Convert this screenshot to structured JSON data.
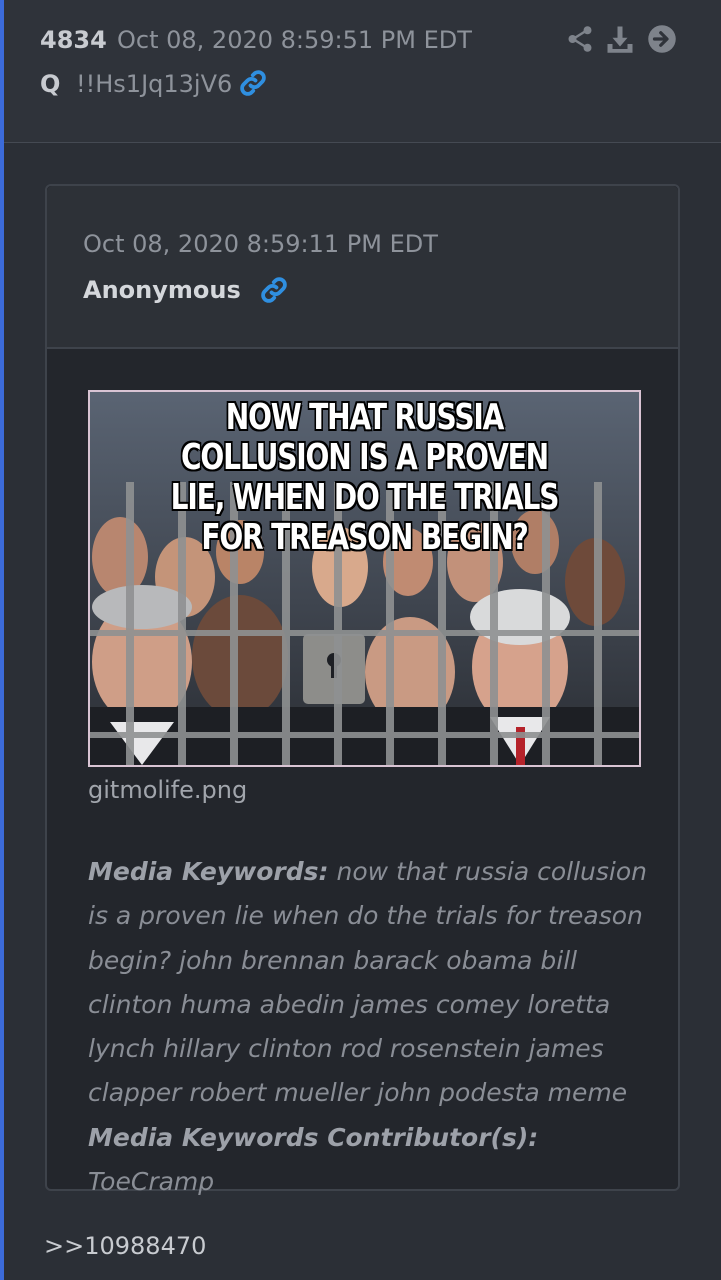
{
  "post": {
    "number": "4834",
    "date": "Oct 08, 2020 8:59:51 PM EDT",
    "author": "Q",
    "tripcode": "!!Hs1Jq13jV6",
    "icons": [
      "share-icon",
      "download-icon",
      "arrow-right-circle-icon",
      "link-icon"
    ]
  },
  "quoted": {
    "date": "Oct 08, 2020 8:59:11 PM EDT",
    "author": "Anonymous",
    "image": {
      "caption": "NOW THAT RUSSIA COLLUSION IS A PROVEN LIE, WHEN DO THE TRIALS FOR TREASON BEGIN?",
      "filename": "gitmolife.png"
    },
    "keywords_label": "Media Keywords:",
    "keywords": "now that russia collusion is a proven lie when do the trials for treason begin? john brennan barack obama bill clinton huma abedin james comey loretta lynch hillary clinton rod rosenstein james clapper robert mueller john podesta meme",
    "contributor_label": "Media Keywords Contributor(s):",
    "contributor": "ToeCramp"
  },
  "reply_ref": ">>10988470",
  "colors": {
    "background": "#2b2f36",
    "accent": "#3c6bd9",
    "link_icon": "#2f8fe0"
  }
}
